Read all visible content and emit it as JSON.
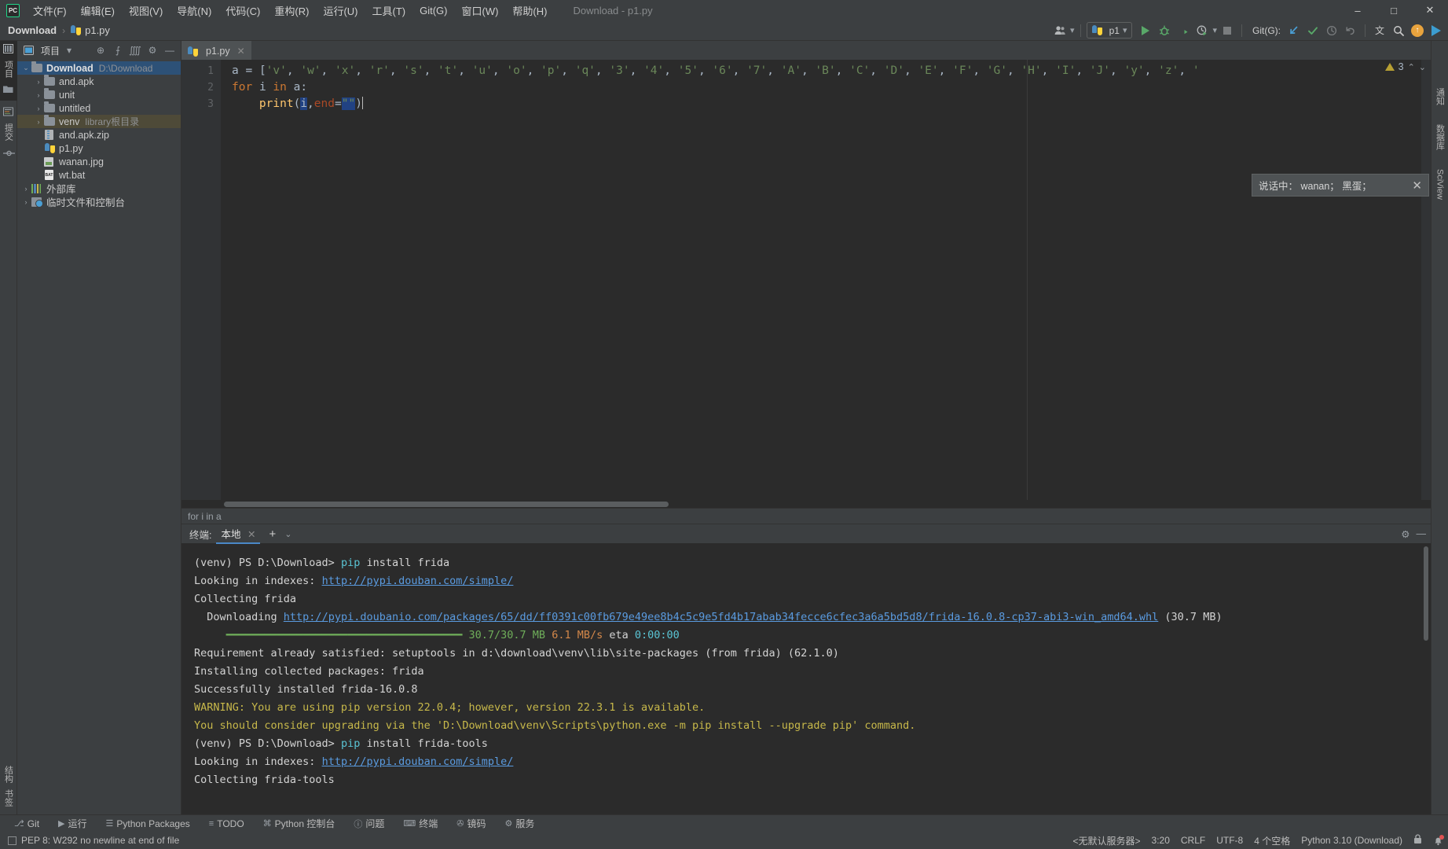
{
  "window": {
    "title": "Download - p1.py",
    "minimize": "–",
    "maximize": "□",
    "close": "✕"
  },
  "menubar": {
    "logo": "PC",
    "items": [
      {
        "label": "文件(F)"
      },
      {
        "label": "编辑(E)"
      },
      {
        "label": "视图(V)"
      },
      {
        "label": "导航(N)"
      },
      {
        "label": "代码(C)"
      },
      {
        "label": "重构(R)"
      },
      {
        "label": "运行(U)"
      },
      {
        "label": "工具(T)"
      },
      {
        "label": "Git(G)"
      },
      {
        "label": "窗口(W)"
      },
      {
        "label": "帮助(H)"
      }
    ]
  },
  "navbar": {
    "breadcrumbs": [
      {
        "label": "Download",
        "bold": true
      },
      {
        "label": "p1.py",
        "bold": false
      }
    ],
    "separator": "›",
    "run_config": "p1",
    "git_label": "Git(G):",
    "icons": {
      "users": "👥",
      "dropdown": "▾",
      "run": "run-icon",
      "debug": "debug-icon",
      "coverage": "coverage-icon",
      "profile": "profile-icon",
      "stop": "stop-icon",
      "update": "↙",
      "commit": "✓",
      "history": "◴",
      "rollback": "↺",
      "translate": "文",
      "search": "⌕"
    }
  },
  "left_strip": {
    "project_label": "项目",
    "commit_label": "提交",
    "structure_label": "结构",
    "bookmark_label": "书签"
  },
  "project_panel": {
    "title": "项目",
    "dropdown": "▾",
    "buttons": {
      "locate": "⊕",
      "expand": "⨍",
      "collapse": "⨌",
      "settings": "⚙",
      "hide": "—"
    },
    "tree": [
      {
        "indent": 0,
        "arrow": "⌄",
        "icon": "folder",
        "label": "Download",
        "sub": "D:\\Download",
        "bold": true,
        "state": "sel"
      },
      {
        "indent": 1,
        "arrow": "›",
        "icon": "folder",
        "label": "and.apk",
        "sub": "",
        "bold": false,
        "state": ""
      },
      {
        "indent": 1,
        "arrow": "›",
        "icon": "folder",
        "label": "unit",
        "sub": "",
        "bold": false,
        "state": ""
      },
      {
        "indent": 1,
        "arrow": "›",
        "icon": "folder",
        "label": "untitled",
        "sub": "",
        "bold": false,
        "state": ""
      },
      {
        "indent": 1,
        "arrow": "›",
        "icon": "folder",
        "label": "venv",
        "sub": "library根目录",
        "bold": false,
        "state": "sel2"
      },
      {
        "indent": 1,
        "arrow": "",
        "icon": "zip",
        "label": "and.apk.zip",
        "sub": "",
        "bold": false,
        "state": ""
      },
      {
        "indent": 1,
        "arrow": "",
        "icon": "py",
        "label": "p1.py",
        "sub": "",
        "bold": false,
        "state": ""
      },
      {
        "indent": 1,
        "arrow": "",
        "icon": "img",
        "label": "wanan.jpg",
        "sub": "",
        "bold": false,
        "state": ""
      },
      {
        "indent": 1,
        "arrow": "",
        "icon": "bat",
        "label": "wt.bat",
        "sub": "",
        "bold": false,
        "state": ""
      },
      {
        "indent": 0,
        "arrow": "›",
        "icon": "lib",
        "label": "外部库",
        "sub": "",
        "bold": false,
        "state": ""
      },
      {
        "indent": 0,
        "arrow": "›",
        "icon": "scratch",
        "label": "临时文件和控制台",
        "sub": "",
        "bold": false,
        "state": ""
      }
    ]
  },
  "editor": {
    "tab": {
      "label": "p1.py",
      "close": "✕"
    },
    "gutter": [
      "1",
      "2",
      "3"
    ],
    "lines": [
      {
        "n": 1,
        "text": "a = ['v', 'w', 'x', 'r', 's', 't', 'u', 'o', 'p', 'q', '3', '4', '5', '6', '7', 'A', 'B', 'C', 'D', 'E', 'F', 'G', 'H', 'I', 'J', 'y', 'z', '"
      },
      {
        "n": 2,
        "text": "for i in a:"
      },
      {
        "n": 3,
        "text": "    print(i,end=\"\")"
      }
    ],
    "inspection_count": "3",
    "chevron_up": "⌃",
    "chevron_down": "⌄",
    "breadcrumb_bottom": "for i in a"
  },
  "balloon": {
    "text": "说话中： wanan； 黑蛋；",
    "close": "✕"
  },
  "terminal": {
    "label": "终端:",
    "tab": "本地",
    "tab_close": "✕",
    "add": "+",
    "chevron": "⌄",
    "settings": "⚙",
    "hide": "—",
    "lines": [
      [
        {
          "t": "(venv) PS D:\\Download> ",
          "c": "t-white"
        },
        {
          "t": "pip",
          "c": "t-cyan"
        },
        {
          "t": " install frida",
          "c": "t-white"
        }
      ],
      [
        {
          "t": "Looking in indexes: ",
          "c": "t-white"
        },
        {
          "t": "http://pypi.douban.com/simple/",
          "c": "t-link"
        }
      ],
      [
        {
          "t": "Collecting frida",
          "c": "t-white"
        }
      ],
      [
        {
          "t": "  Downloading ",
          "c": "t-white"
        },
        {
          "t": "http://pypi.doubanio.com/packages/65/dd/ff0391c00fb679e49ee8b4c5c9e5fd4b17abab34fecce6cfec3a6a5bd5d8/frida-16.0.8-cp37-abi3-win_amd64.whl",
          "c": "t-link"
        },
        {
          "t": " (30.7 MB)",
          "c": "t-white"
        }
      ],
      [
        {
          "t": "     ━━━━━━━━━━━━━━━━━━━━━━━━━━━━━━━━━━━━━ ",
          "c": "t-bar"
        },
        {
          "t": "30.7/30.7 MB",
          "c": "t-green"
        },
        {
          "t": " ",
          "c": "t-white"
        },
        {
          "t": "6.1 MB/s",
          "c": "t-red"
        },
        {
          "t": " eta ",
          "c": "t-white"
        },
        {
          "t": "0:00:00",
          "c": "t-cyan"
        }
      ],
      [
        {
          "t": "Requirement already satisfied: setuptools in d:\\download\\venv\\lib\\site-packages (from frida) (62.1.0)",
          "c": "t-white"
        }
      ],
      [
        {
          "t": "Installing collected packages: frida",
          "c": "t-white"
        }
      ],
      [
        {
          "t": "Successfully installed frida-16.0.8",
          "c": "t-white"
        }
      ],
      [
        {
          "t": "WARNING: You are using pip version 22.0.4; however, version 22.3.1 is available.",
          "c": "t-yellow"
        }
      ],
      [
        {
          "t": "You should consider upgrading via the 'D:\\Download\\venv\\Scripts\\python.exe -m pip install --upgrade pip' command.",
          "c": "t-yellow"
        }
      ],
      [
        {
          "t": "(venv) PS D:\\Download> ",
          "c": "t-white"
        },
        {
          "t": "pip",
          "c": "t-cyan"
        },
        {
          "t": " install frida-tools",
          "c": "t-white"
        }
      ],
      [
        {
          "t": "Looking in indexes: ",
          "c": "t-white"
        },
        {
          "t": "http://pypi.douban.com/simple/",
          "c": "t-link"
        }
      ],
      [
        {
          "t": "Collecting frida-tools",
          "c": "t-white"
        }
      ]
    ]
  },
  "right_strip": {
    "notifications_label": "通知",
    "database_label": "数据库",
    "sciview_label": "SciView"
  },
  "bottom_tools": [
    {
      "icon": "⎇",
      "label": "Git"
    },
    {
      "icon": "▶",
      "label": "运行"
    },
    {
      "icon": "☰",
      "label": "Python Packages"
    },
    {
      "icon": "≡",
      "label": "TODO"
    },
    {
      "icon": "⌘",
      "label": "Python 控制台"
    },
    {
      "icon": "ⓘ",
      "label": "问题"
    },
    {
      "icon": "⌨",
      "label": "终端"
    },
    {
      "icon": "✇",
      "label": "镜码"
    },
    {
      "icon": "⚙",
      "label": "服务"
    }
  ],
  "statusbar": {
    "message": "PEP 8: W292 no newline at end of file",
    "server": "<无默认服务器>",
    "caret": "3:20",
    "line_sep": "CRLF",
    "encoding": "UTF-8",
    "indent": "4 个空格",
    "interpreter": "Python 3.10 (Download)",
    "lock": "🔒",
    "bell": "🔔"
  },
  "colors": {
    "bg": "#3c3f41",
    "editor_bg": "#2b2b2b",
    "accent_green": "#59a869",
    "accent_blue": "#4a88c7",
    "selection": "#2d5177"
  }
}
